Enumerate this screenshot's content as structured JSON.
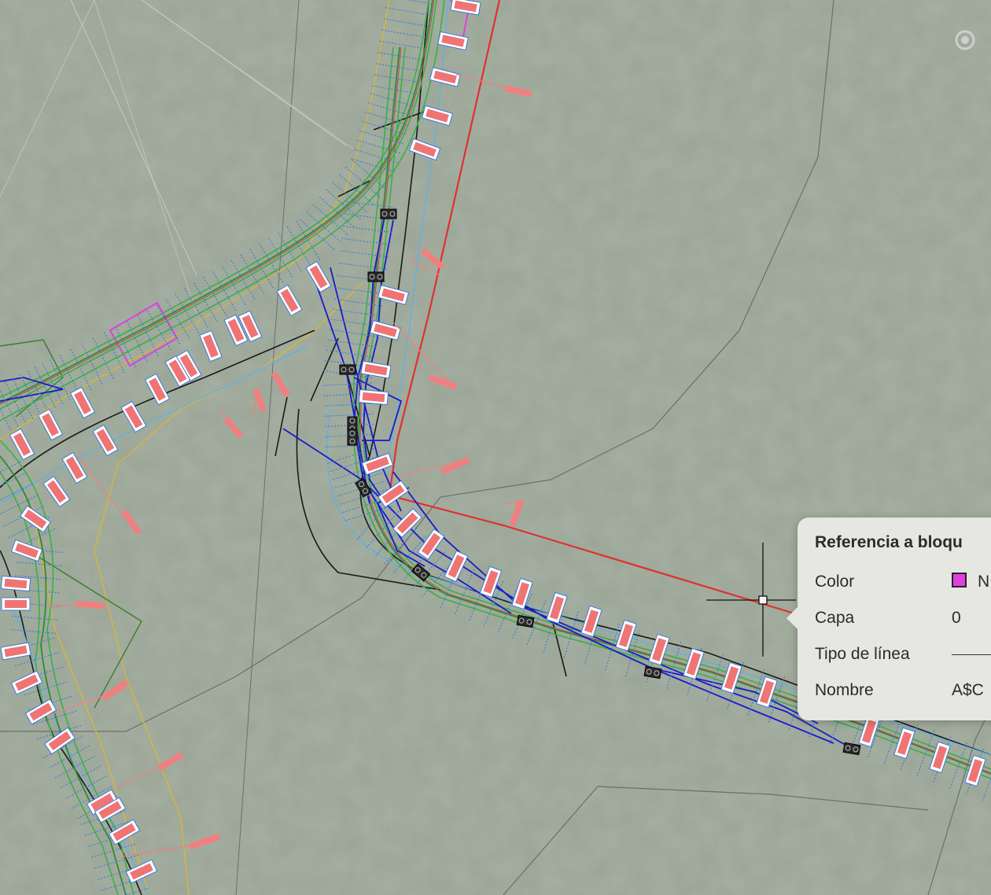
{
  "viewport": {
    "background_color": "#9aa596",
    "layers": {
      "road_centerline_color": "#2e8b2e",
      "road_edge_color": "#3cb043",
      "dimension_color": "#3a7bd5",
      "block_color": "#f08080",
      "boundary_color": "#e03030",
      "construction_color": "#1a1acc"
    }
  },
  "tooltip": {
    "title": "Referencia a bloqu",
    "rows": [
      {
        "label": "Color",
        "value": "N",
        "swatch_color": "#e040e0"
      },
      {
        "label": "Capa",
        "value": "0"
      },
      {
        "label": "Tipo de línea",
        "value": ""
      },
      {
        "label": "Nombre",
        "value": "A$C"
      }
    ]
  },
  "icons": {
    "compass": "compass-icon",
    "cursor": "crosshair-cursor-icon"
  }
}
